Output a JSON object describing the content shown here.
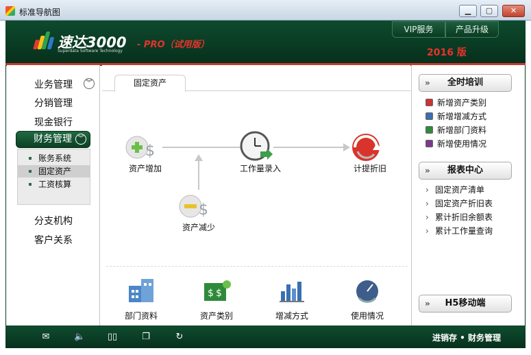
{
  "window": {
    "title": "标准导航图",
    "min": "▁",
    "max": "▢",
    "close": "✕"
  },
  "header": {
    "logo_main": "速达3000",
    "logo_pro": "- PRO（试用版）",
    "logo_sub": "Superdata Software Technology",
    "vip_label": "VIP服务",
    "upgrade_label": "产品升级",
    "year": "2016 版"
  },
  "sidebar": {
    "items": [
      {
        "label": "业务管理"
      },
      {
        "label": "分销管理"
      },
      {
        "label": "现金银行"
      },
      {
        "label": "财务管理"
      },
      {
        "label": "分支机构"
      },
      {
        "label": "客户关系"
      }
    ],
    "subitems": [
      {
        "label": "账务系统"
      },
      {
        "label": "固定资产"
      },
      {
        "label": "工资核算"
      }
    ]
  },
  "center": {
    "tab": "固定资产",
    "flow": {
      "add": "资产增加",
      "workload": "工作量录入",
      "depreciation": "计提折旧",
      "reduce": "资产减少"
    },
    "bottom": [
      {
        "label": "部门资料"
      },
      {
        "label": "资产类别"
      },
      {
        "label": "增减方式"
      },
      {
        "label": "使用情况"
      }
    ]
  },
  "right": {
    "training_title": "全时培训",
    "training_links": [
      {
        "label": "新增资产类别"
      },
      {
        "label": "新增增减方式"
      },
      {
        "label": "新增部门资料"
      },
      {
        "label": "新增使用情况"
      }
    ],
    "report_title": "报表中心",
    "report_links": [
      {
        "label": "固定资产清单"
      },
      {
        "label": "固定资产折旧表"
      },
      {
        "label": "累计折旧余额表"
      },
      {
        "label": "累计工作量查询"
      }
    ],
    "mobile_title": "H5移动端"
  },
  "footer": {
    "text": "进销存 • 财务管理"
  },
  "colors": {
    "brand_green": "#0c3f24",
    "accent_red": "#e8322a"
  }
}
